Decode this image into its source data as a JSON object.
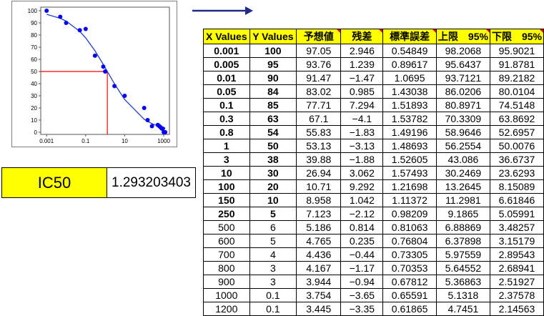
{
  "ic50": {
    "label": "IC50",
    "value": "1.293203403"
  },
  "table": {
    "headers": [
      "X Values",
      "Y Values",
      "予想値",
      "残差",
      "標準誤差",
      "上限　95%",
      "下限　95%"
    ],
    "rows": [
      [
        "0.001",
        "100",
        "97.05",
        "2.946",
        "0.54849",
        "98.2068",
        "95.9021"
      ],
      [
        "0.005",
        "95",
        "93.76",
        "1.239",
        "0.89617",
        "95.6437",
        "91.8781"
      ],
      [
        "0.01",
        "90",
        "91.47",
        "−1.47",
        "1.0695",
        "93.7121",
        "89.2182"
      ],
      [
        "0.05",
        "84",
        "83.02",
        "0.985",
        "1.43038",
        "86.0206",
        "80.0104"
      ],
      [
        "0.1",
        "85",
        "77.71",
        "7.294",
        "1.51893",
        "80.8971",
        "74.5148"
      ],
      [
        "0.3",
        "63",
        "67.1",
        "−4.1",
        "1.53782",
        "70.3309",
        "63.8692"
      ],
      [
        "0.8",
        "54",
        "55.83",
        "−1.83",
        "1.49196",
        "58.9646",
        "52.6957"
      ],
      [
        "1",
        "50",
        "53.13",
        "−3.13",
        "1.48693",
        "56.2554",
        "50.0076"
      ],
      [
        "3",
        "38",
        "39.88",
        "−1.88",
        "1.52605",
        "43.086",
        "36.6737"
      ],
      [
        "10",
        "30",
        "26.94",
        "3.062",
        "1.57493",
        "30.2469",
        "23.6293"
      ],
      [
        "100",
        "20",
        "10.71",
        "9.292",
        "1.21698",
        "13.2645",
        "8.15089"
      ],
      [
        "150",
        "10",
        "8.958",
        "1.042",
        "1.11372",
        "11.2981",
        "6.61846"
      ],
      [
        "250",
        "5",
        "7.123",
        "−2.12",
        "0.98209",
        "9.1865",
        "5.05991"
      ],
      [
        "500",
        "6",
        "5.186",
        "0.814",
        "0.81063",
        "6.88869",
        "3.48257"
      ],
      [
        "600",
        "5",
        "4.765",
        "0.235",
        "0.76804",
        "6.37898",
        "3.15179"
      ],
      [
        "700",
        "4",
        "4.436",
        "−0.44",
        "0.73305",
        "5.97559",
        "2.89543"
      ],
      [
        "800",
        "3",
        "4.167",
        "−1.17",
        "0.70353",
        "5.64552",
        "2.68941"
      ],
      [
        "900",
        "3",
        "3.944",
        "−0.94",
        "0.67812",
        "5.36863",
        "2.51927"
      ],
      [
        "1000",
        "0.1",
        "3.754",
        "−3.65",
        "0.65591",
        "5.1318",
        "2.37578"
      ],
      [
        "1200",
        "0.1",
        "3.445",
        "−3.35",
        "0.61865",
        "4.7451",
        "2.14563"
      ]
    ]
  },
  "chart_data": {
    "type": "scatter",
    "xscale": "log",
    "xlim": [
      0.001,
      1200
    ],
    "ylim": [
      0,
      100
    ],
    "xticks": [
      "0.001",
      "0.1",
      "10",
      "1000"
    ],
    "yticks": [
      "0",
      "10",
      "20",
      "30",
      "40",
      "50",
      "60",
      "70",
      "80",
      "90",
      "100"
    ],
    "points": {
      "x": [
        0.001,
        0.005,
        0.01,
        0.05,
        0.1,
        0.3,
        0.8,
        1,
        3,
        10,
        100,
        150,
        250,
        500,
        600,
        700,
        800,
        900,
        1000,
        1200
      ],
      "y": [
        100,
        95,
        90,
        84,
        85,
        63,
        54,
        50,
        38,
        30,
        20,
        10,
        5,
        6,
        5,
        4,
        3,
        3,
        0.1,
        0.1
      ]
    },
    "fit": {
      "x": [
        0.001,
        0.005,
        0.01,
        0.05,
        0.1,
        0.3,
        0.8,
        1,
        3,
        10,
        100,
        150,
        250,
        500,
        600,
        700,
        800,
        900,
        1000,
        1200
      ],
      "y": [
        97.05,
        93.76,
        91.47,
        83.02,
        77.71,
        67.1,
        55.83,
        53.13,
        39.88,
        26.94,
        10.71,
        8.958,
        7.123,
        5.186,
        4.765,
        4.436,
        4.167,
        3.944,
        3.754,
        3.445
      ]
    },
    "ic50_marker": {
      "x": 1.293203403,
      "y": 50
    },
    "colors": {
      "points": "#0000ff",
      "fit": "#1f3fbf",
      "marker": "#ff0000"
    },
    "grid": false
  }
}
